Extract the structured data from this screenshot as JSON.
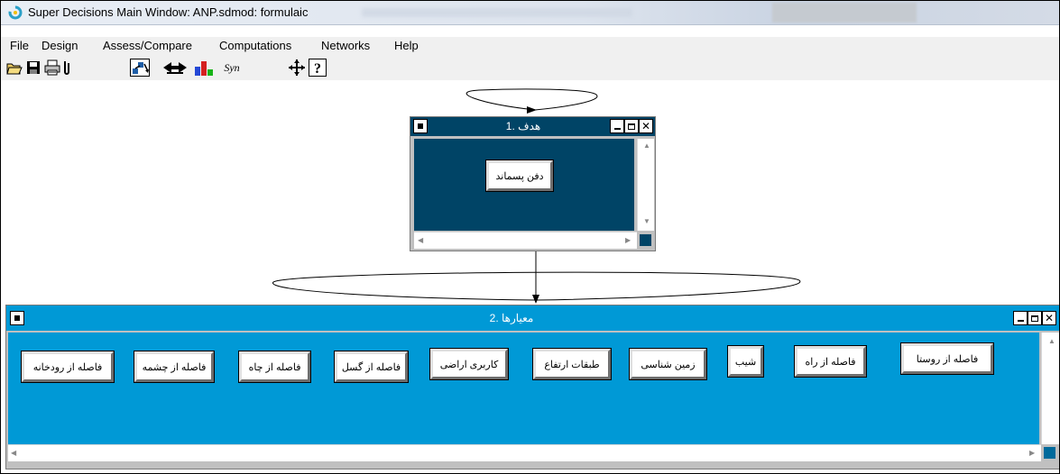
{
  "window": {
    "title": "Super Decisions Main Window: ANP.sdmod: formulaic"
  },
  "menu": [
    "File",
    "Design",
    "Assess/Compare",
    "Computations",
    "Networks",
    "Help"
  ],
  "toolbar": {
    "buttons": [
      {
        "name": "open-icon",
        "glyph": "📂"
      },
      {
        "name": "save-icon",
        "glyph": "💾"
      },
      {
        "name": "print-icon",
        "glyph": "🖶"
      },
      {
        "name": "attach-icon",
        "glyph": "🔗"
      },
      {
        "name": "connect-nodes-icon",
        "glyph": ""
      },
      {
        "name": "compare-icon",
        "glyph": ""
      },
      {
        "name": "bar-chart-icon",
        "glyph": ""
      },
      {
        "name": "synthesize-icon",
        "glyph": "Syn"
      },
      {
        "name": "move-icon",
        "glyph": "✣"
      },
      {
        "name": "help-icon",
        "glyph": "?"
      }
    ]
  },
  "clusters": [
    {
      "title": "هدف .1",
      "nodes": [
        "دفن پسماند"
      ]
    },
    {
      "title": "معیارها .2",
      "nodes": [
        "فاصله از رودخانه",
        "فاصله از چشمه",
        "فاصله از چاه",
        "فاصله از گسل",
        "کاربری اراضی",
        "طبقات ارتفاع",
        "زمین شناسی",
        "شیب",
        "فاصله از راه",
        "فاصله از روستا"
      ]
    }
  ],
  "colors": {
    "cluster1_bg": "#004466",
    "cluster2_bg": "#0099d6",
    "node_bg": "#ffffff",
    "chrome": "#f0f0f0"
  }
}
